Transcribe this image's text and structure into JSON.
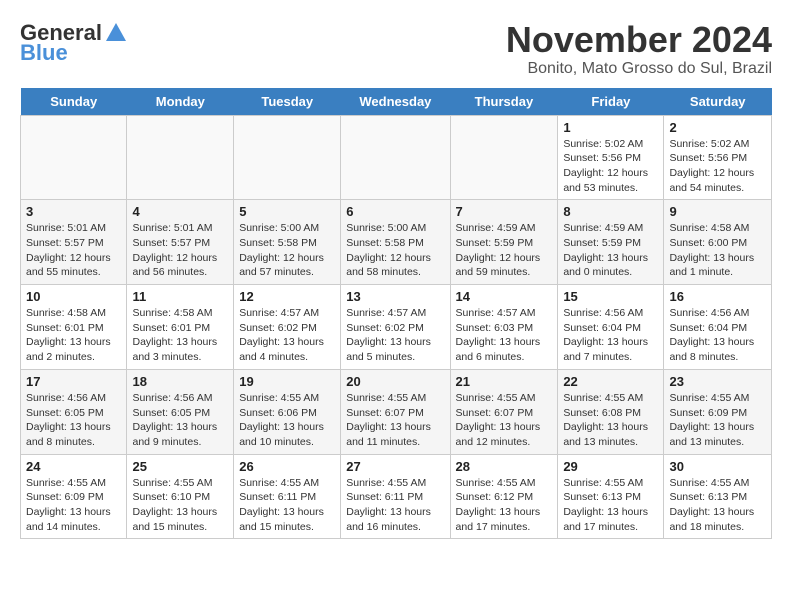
{
  "logo": {
    "general": "General",
    "blue": "Blue"
  },
  "title": "November 2024",
  "subtitle": "Bonito, Mato Grosso do Sul, Brazil",
  "headers": [
    "Sunday",
    "Monday",
    "Tuesday",
    "Wednesday",
    "Thursday",
    "Friday",
    "Saturday"
  ],
  "weeks": [
    [
      {
        "day": "",
        "info": ""
      },
      {
        "day": "",
        "info": ""
      },
      {
        "day": "",
        "info": ""
      },
      {
        "day": "",
        "info": ""
      },
      {
        "day": "",
        "info": ""
      },
      {
        "day": "1",
        "info": "Sunrise: 5:02 AM\nSunset: 5:56 PM\nDaylight: 12 hours\nand 53 minutes."
      },
      {
        "day": "2",
        "info": "Sunrise: 5:02 AM\nSunset: 5:56 PM\nDaylight: 12 hours\nand 54 minutes."
      }
    ],
    [
      {
        "day": "3",
        "info": "Sunrise: 5:01 AM\nSunset: 5:57 PM\nDaylight: 12 hours\nand 55 minutes."
      },
      {
        "day": "4",
        "info": "Sunrise: 5:01 AM\nSunset: 5:57 PM\nDaylight: 12 hours\nand 56 minutes."
      },
      {
        "day": "5",
        "info": "Sunrise: 5:00 AM\nSunset: 5:58 PM\nDaylight: 12 hours\nand 57 minutes."
      },
      {
        "day": "6",
        "info": "Sunrise: 5:00 AM\nSunset: 5:58 PM\nDaylight: 12 hours\nand 58 minutes."
      },
      {
        "day": "7",
        "info": "Sunrise: 4:59 AM\nSunset: 5:59 PM\nDaylight: 12 hours\nand 59 minutes."
      },
      {
        "day": "8",
        "info": "Sunrise: 4:59 AM\nSunset: 5:59 PM\nDaylight: 13 hours\nand 0 minutes."
      },
      {
        "day": "9",
        "info": "Sunrise: 4:58 AM\nSunset: 6:00 PM\nDaylight: 13 hours\nand 1 minute."
      }
    ],
    [
      {
        "day": "10",
        "info": "Sunrise: 4:58 AM\nSunset: 6:01 PM\nDaylight: 13 hours\nand 2 minutes."
      },
      {
        "day": "11",
        "info": "Sunrise: 4:58 AM\nSunset: 6:01 PM\nDaylight: 13 hours\nand 3 minutes."
      },
      {
        "day": "12",
        "info": "Sunrise: 4:57 AM\nSunset: 6:02 PM\nDaylight: 13 hours\nand 4 minutes."
      },
      {
        "day": "13",
        "info": "Sunrise: 4:57 AM\nSunset: 6:02 PM\nDaylight: 13 hours\nand 5 minutes."
      },
      {
        "day": "14",
        "info": "Sunrise: 4:57 AM\nSunset: 6:03 PM\nDaylight: 13 hours\nand 6 minutes."
      },
      {
        "day": "15",
        "info": "Sunrise: 4:56 AM\nSunset: 6:04 PM\nDaylight: 13 hours\nand 7 minutes."
      },
      {
        "day": "16",
        "info": "Sunrise: 4:56 AM\nSunset: 6:04 PM\nDaylight: 13 hours\nand 8 minutes."
      }
    ],
    [
      {
        "day": "17",
        "info": "Sunrise: 4:56 AM\nSunset: 6:05 PM\nDaylight: 13 hours\nand 8 minutes."
      },
      {
        "day": "18",
        "info": "Sunrise: 4:56 AM\nSunset: 6:05 PM\nDaylight: 13 hours\nand 9 minutes."
      },
      {
        "day": "19",
        "info": "Sunrise: 4:55 AM\nSunset: 6:06 PM\nDaylight: 13 hours\nand 10 minutes."
      },
      {
        "day": "20",
        "info": "Sunrise: 4:55 AM\nSunset: 6:07 PM\nDaylight: 13 hours\nand 11 minutes."
      },
      {
        "day": "21",
        "info": "Sunrise: 4:55 AM\nSunset: 6:07 PM\nDaylight: 13 hours\nand 12 minutes."
      },
      {
        "day": "22",
        "info": "Sunrise: 4:55 AM\nSunset: 6:08 PM\nDaylight: 13 hours\nand 13 minutes."
      },
      {
        "day": "23",
        "info": "Sunrise: 4:55 AM\nSunset: 6:09 PM\nDaylight: 13 hours\nand 13 minutes."
      }
    ],
    [
      {
        "day": "24",
        "info": "Sunrise: 4:55 AM\nSunset: 6:09 PM\nDaylight: 13 hours\nand 14 minutes."
      },
      {
        "day": "25",
        "info": "Sunrise: 4:55 AM\nSunset: 6:10 PM\nDaylight: 13 hours\nand 15 minutes."
      },
      {
        "day": "26",
        "info": "Sunrise: 4:55 AM\nSunset: 6:11 PM\nDaylight: 13 hours\nand 15 minutes."
      },
      {
        "day": "27",
        "info": "Sunrise: 4:55 AM\nSunset: 6:11 PM\nDaylight: 13 hours\nand 16 minutes."
      },
      {
        "day": "28",
        "info": "Sunrise: 4:55 AM\nSunset: 6:12 PM\nDaylight: 13 hours\nand 17 minutes."
      },
      {
        "day": "29",
        "info": "Sunrise: 4:55 AM\nSunset: 6:13 PM\nDaylight: 13 hours\nand 17 minutes."
      },
      {
        "day": "30",
        "info": "Sunrise: 4:55 AM\nSunset: 6:13 PM\nDaylight: 13 hours\nand 18 minutes."
      }
    ]
  ]
}
